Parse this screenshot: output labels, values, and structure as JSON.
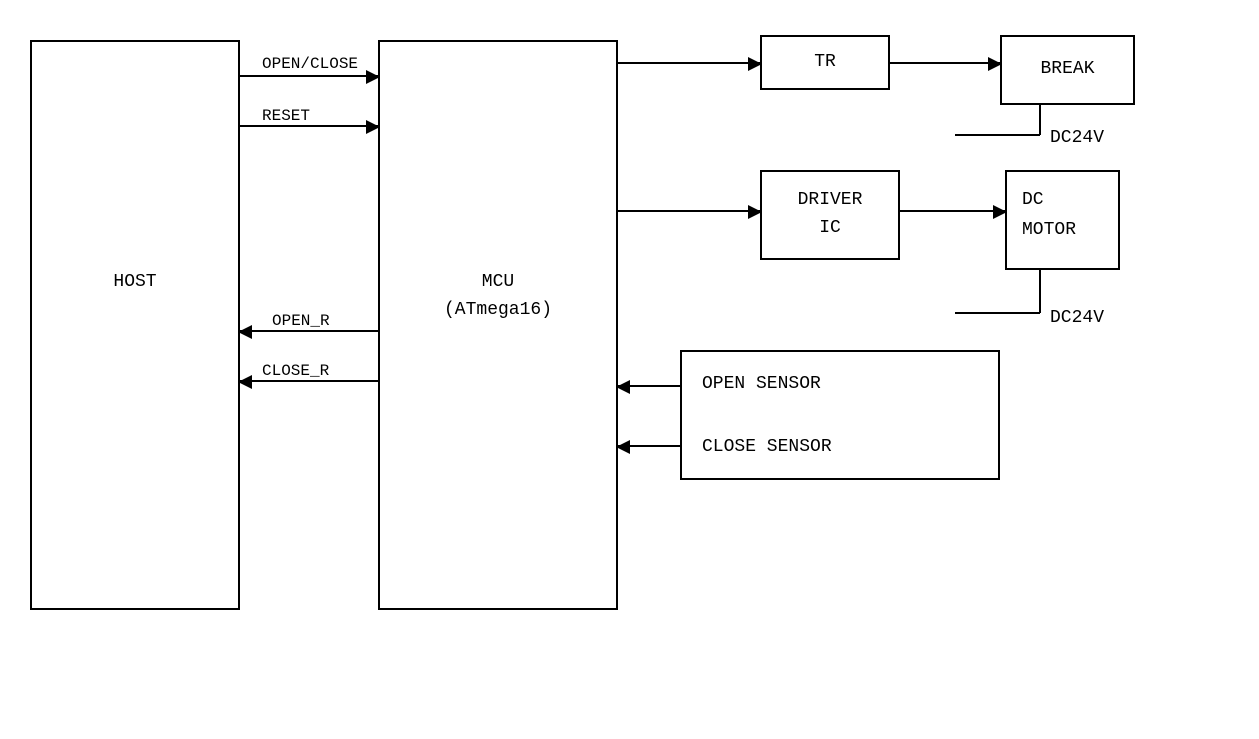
{
  "blocks": {
    "host": "HOST",
    "mcu_line1": "MCU",
    "mcu_line2": "(ATmega16)",
    "tr": "TR",
    "break": "BREAK",
    "driver_line1": "DRIVER",
    "driver_line2": "IC",
    "dcmotor_line1": "DC",
    "dcmotor_line2": "MOTOR",
    "open_sensor": "OPEN SENSOR",
    "close_sensor": "CLOSE SENSOR"
  },
  "signals": {
    "open_close": "OPEN/CLOSE",
    "reset": "RESET",
    "open_r": "OPEN_R",
    "close_r": "CLOSE_R"
  },
  "power": {
    "dc24v_1": "DC24V",
    "dc24v_2": "DC24V"
  }
}
